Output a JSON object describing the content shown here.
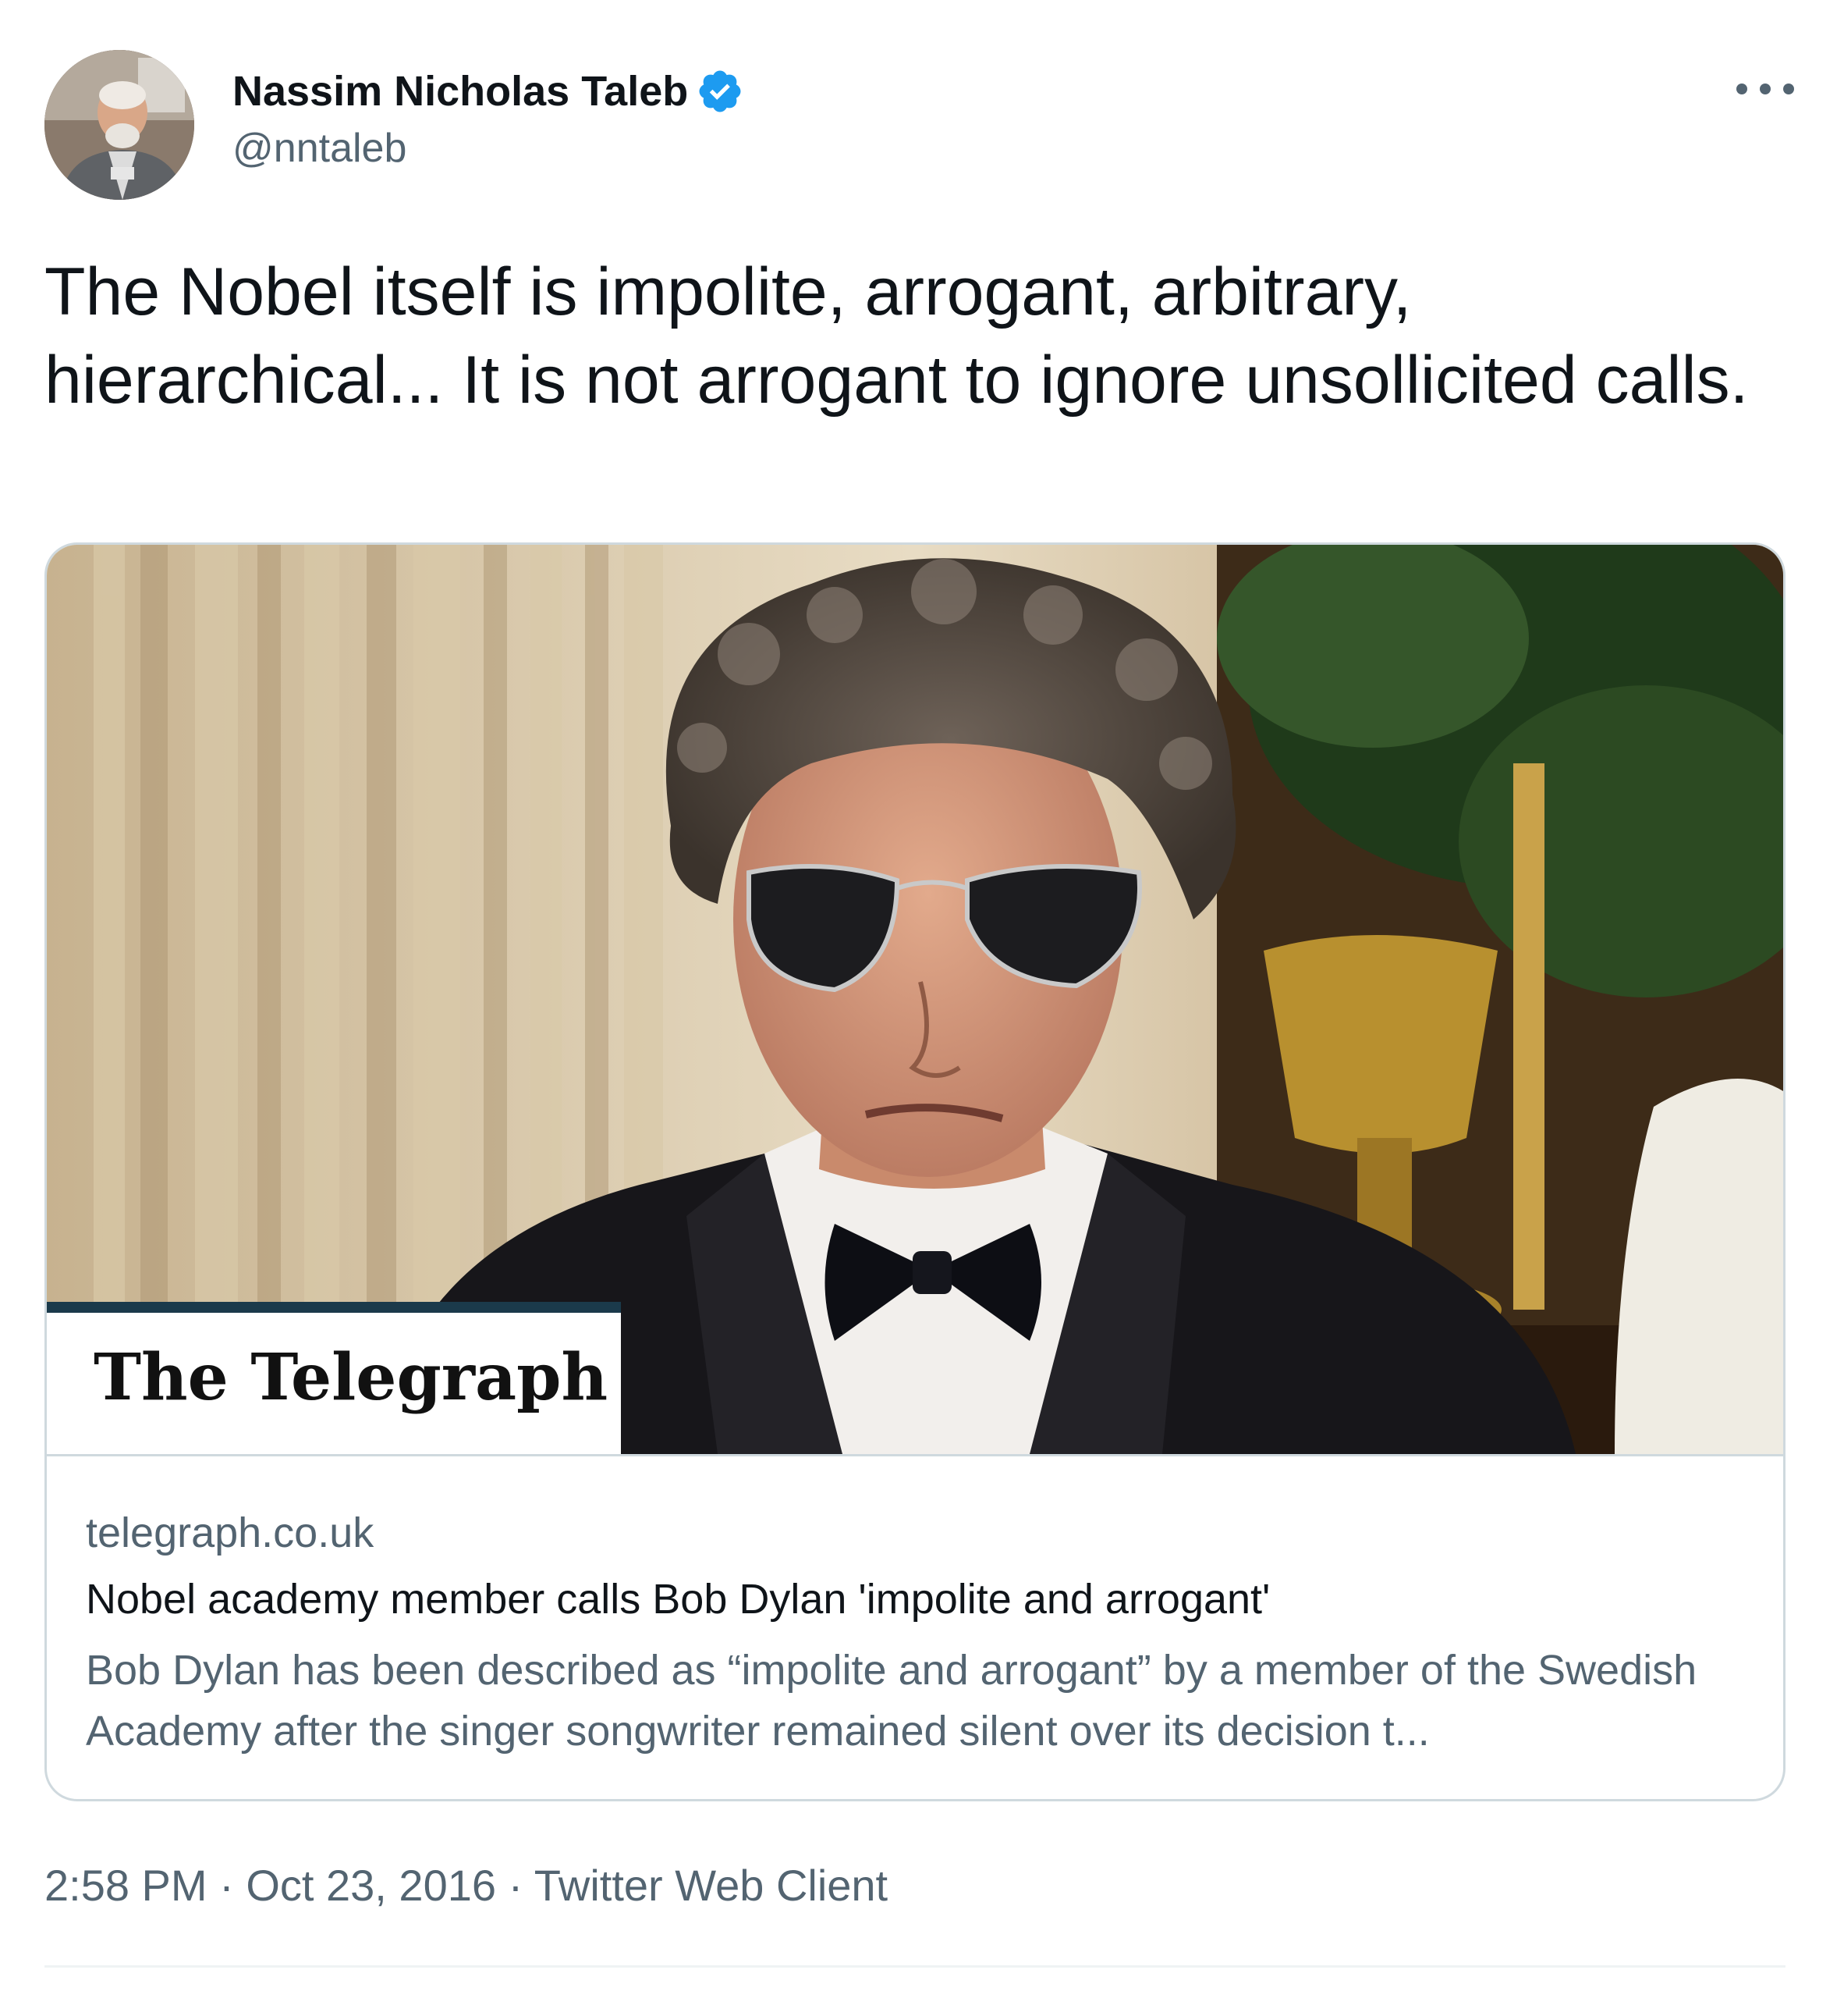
{
  "author": {
    "display_name": "Nassim Nicholas Taleb",
    "handle": "@nntaleb",
    "verified": true,
    "verified_color": "#1d9bf0"
  },
  "tweet": {
    "text": "The Nobel itself is impolite, arrogant, arbitrary, hierarchical... It is not arrogant to ignore unsollicited calls."
  },
  "card": {
    "image_logo_text": "The Telegraph",
    "domain": "telegraph.co.uk",
    "title": "Nobel academy member calls Bob Dylan 'impolite and arrogant'",
    "description": "Bob Dylan has been described as “impolite and arrogant” by a member of the Swedish Academy after the singer songwriter remained silent over its decision t..."
  },
  "meta": {
    "time": "2:58 PM",
    "separator": "·",
    "date": "Oct 23, 2016",
    "source": "Twitter Web Client"
  },
  "icons": {
    "more": "more-horizontal-icon",
    "verified": "verified-badge-icon"
  },
  "colors": {
    "text_primary": "#0f1419",
    "text_secondary": "#536471",
    "border": "#cfd9de",
    "telegraph_banner_bar": "#1b3a4b"
  }
}
